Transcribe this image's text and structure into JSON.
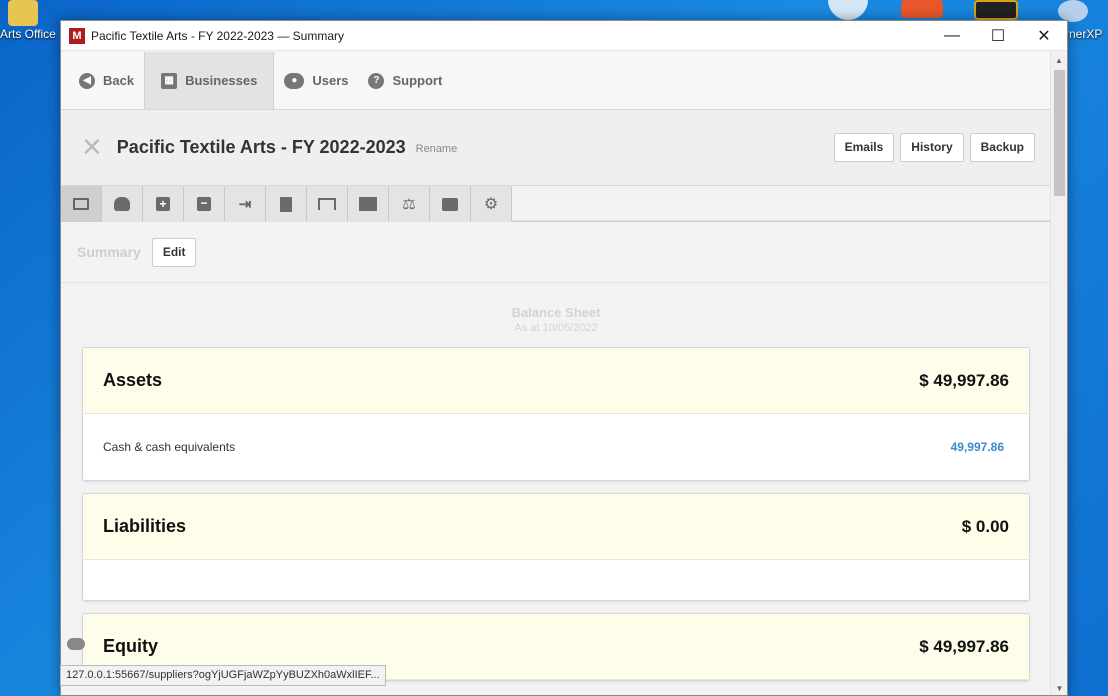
{
  "desktop": {
    "icon_left_label": "Arts Office",
    "icon_right_label": "rnerXP"
  },
  "window": {
    "title": "Pacific Textile Arts - FY 2022-2023 — Summary",
    "logo_letter": "M",
    "controls": {
      "minimize": "—",
      "maximize": "☐",
      "close": "✕"
    }
  },
  "nav": {
    "back": "Back",
    "businesses": "Businesses",
    "users": "Users",
    "support": "Support"
  },
  "business": {
    "name": "Pacific Textile Arts - FY 2022-2023",
    "rename": "Rename",
    "buttons": {
      "emails": "Emails",
      "history": "History",
      "backup": "Backup"
    }
  },
  "toolbar": {
    "tools": [
      "summary-icon",
      "coins-icon",
      "plus-square-icon",
      "minus-square-icon",
      "arrow-right-bar-icon",
      "clipboard-check-icon",
      "presentation-icon",
      "buildings-icon",
      "balance-scale-icon",
      "print-icon",
      "gear-icon"
    ]
  },
  "summary": {
    "label": "Summary",
    "edit": "Edit"
  },
  "report": {
    "title": "Balance Sheet",
    "date": "As at 10/05/2022"
  },
  "sections": {
    "assets": {
      "title": "Assets",
      "total": "$ 49,997.86",
      "rows": [
        {
          "label": "Cash & cash equivalents",
          "value": "49,997.86"
        }
      ]
    },
    "liabilities": {
      "title": "Liabilities",
      "total": "$ 0.00"
    },
    "equity": {
      "title": "Equity",
      "total": "$ 49,997.86"
    }
  },
  "status": {
    "url": "127.0.0.1:55667/suppliers?ogYjUGFjaWZpYyBUZXh0aWxlIEF..."
  },
  "colors": {
    "section_header_bg": "#fdfde9",
    "link_value": "#3a8ad0",
    "logo": "#b01c1c"
  }
}
